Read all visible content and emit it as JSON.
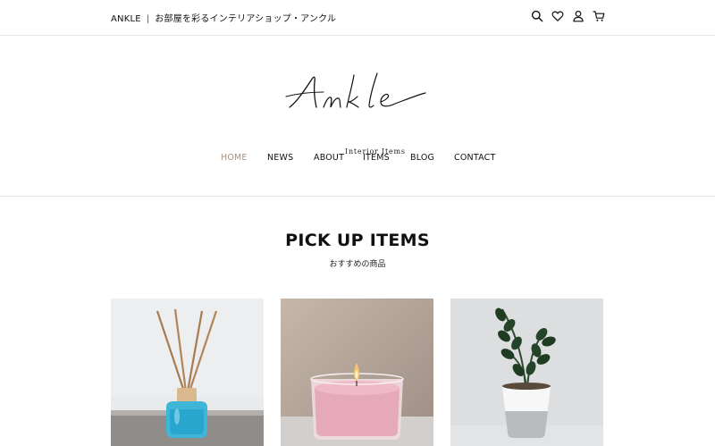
{
  "topbar": {
    "brand": "ANKLE",
    "separator": "|",
    "tagline": "お部屋を彩るインテリアショップ・アンクル",
    "icons": [
      "search-icon",
      "heart-icon",
      "user-icon",
      "cart-icon"
    ]
  },
  "logo": {
    "wordmark": "Ankle",
    "subtitle": "Interior Items"
  },
  "nav": {
    "items": [
      {
        "label": "HOME",
        "active": true
      },
      {
        "label": "NEWS",
        "active": false
      },
      {
        "label": "ABOUT",
        "active": false
      },
      {
        "label": "ITEMS",
        "active": false
      },
      {
        "label": "BLOG",
        "active": false
      },
      {
        "label": "CONTACT",
        "active": false
      }
    ],
    "active_color": "#a8917f"
  },
  "pickup": {
    "title": "PICK UP ITEMS",
    "subtitle": "おすすめの商品",
    "items": [
      {
        "image": "reed-diffuser"
      },
      {
        "image": "pink-candle"
      },
      {
        "image": "potted-plant"
      }
    ]
  }
}
